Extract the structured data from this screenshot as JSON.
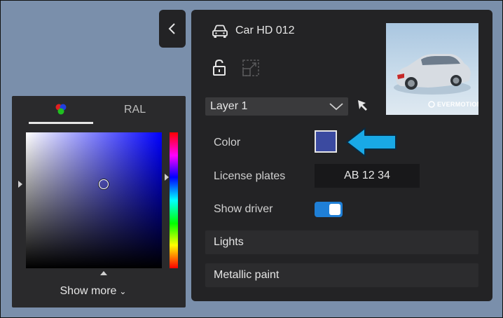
{
  "colors": {
    "background": "#7a8fab",
    "panel": "#232325",
    "selected_color": "#3b4aa0",
    "toggle_on": "#1f7fd6",
    "callout_arrow": "#19a9e6"
  },
  "picker": {
    "tabs": [
      {
        "icon": "rgb-dots-icon",
        "active": true
      },
      {
        "label": "RAL",
        "active": false
      }
    ],
    "saturation": 0.57,
    "value": 0.62,
    "hue_fraction": 0.33,
    "show_more_label": "Show more"
  },
  "main": {
    "title": "Car HD 012",
    "thumbnail_brand": "EVERMOTION",
    "layer_select": {
      "value": "Layer 1"
    },
    "properties": {
      "color_label": "Color",
      "license_label": "License plates",
      "license_value": "AB 12 34",
      "driver_label": "Show driver",
      "driver_on": true
    },
    "sections": [
      {
        "label": "Lights"
      },
      {
        "label": "Metallic paint"
      }
    ]
  }
}
